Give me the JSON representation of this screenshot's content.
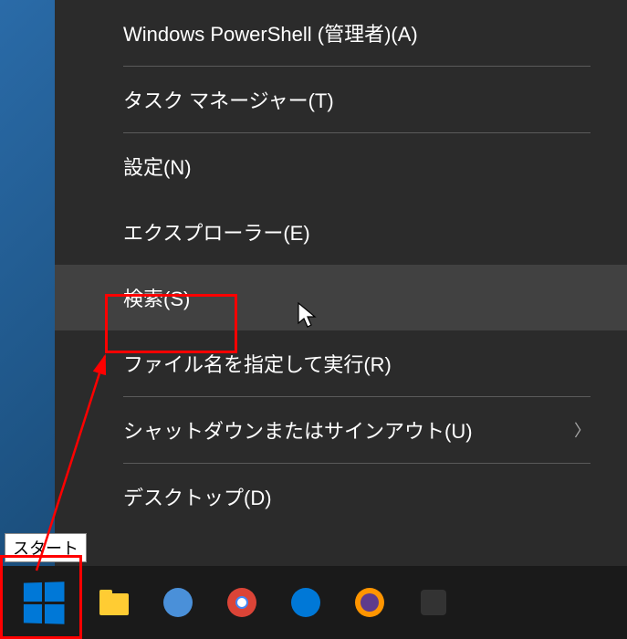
{
  "menu": {
    "partial_item": "",
    "items": [
      {
        "label": "Windows PowerShell (管理者)(A)",
        "hover": false,
        "chevron": false
      },
      {
        "divider": true
      },
      {
        "label": "タスク マネージャー(T)",
        "hover": false,
        "chevron": false
      },
      {
        "divider": true
      },
      {
        "label": "設定(N)",
        "hover": false,
        "chevron": false
      },
      {
        "label": "エクスプローラー(E)",
        "hover": false,
        "chevron": false
      },
      {
        "label": "検索(S)",
        "hover": true,
        "chevron": false
      },
      {
        "label": "ファイル名を指定して実行(R)",
        "hover": false,
        "chevron": false
      },
      {
        "divider": true
      },
      {
        "label": "シャットダウンまたはサインアウト(U)",
        "hover": false,
        "chevron": true
      },
      {
        "divider": true
      },
      {
        "label": "デスクトップ(D)",
        "hover": false,
        "chevron": false
      }
    ]
  },
  "tooltip": "スタート",
  "annotations": {
    "search_highlight": true,
    "start_highlight": true,
    "arrow": true
  }
}
